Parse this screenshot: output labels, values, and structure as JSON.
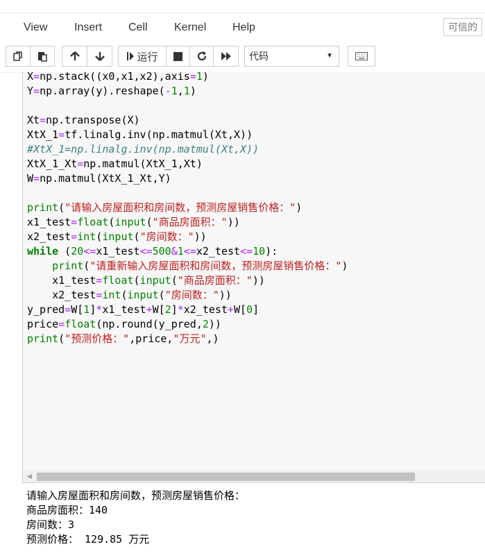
{
  "menubar": {
    "items": [
      "View",
      "Insert",
      "Cell",
      "Kernel",
      "Help"
    ],
    "trusted_label": "可信的"
  },
  "toolbar": {
    "run_label": "运行",
    "cell_type": "代码"
  },
  "code_lines": [
    "X=np.stack((x0,x1,x2),axis=1)",
    "Y=np.array(y).reshape(-1,1)",
    "",
    "Xt=np.transpose(X)",
    "XtX_1=tf.linalg.inv(np.matmul(Xt,X))",
    "#XtX_1=np.linalg.inv(np.matmul(Xt,X))",
    "XtX_1_Xt=np.matmul(XtX_1,Xt)",
    "W=np.matmul(XtX_1_Xt,Y)",
    "",
    "print(\"请输入房屋面积和房间数，预测房屋销售价格：\")",
    "x1_test=float(input(\"商品房面积：\"))",
    "x2_test=int(input(\"房间数：\"))",
    "while (20<=x1_test<=500&1<=x2_test<=10):",
    "    print(\"请重新输入房屋面积和房间数，预测房屋销售价格：\")",
    "    x1_test=float(input(\"商品房面积：\"))",
    "    x2_test=int(input(\"房间数：\"))",
    "y_pred=W[1]*x1_test+W[2]*x2_test+W[0]",
    "price=float(np.round(y_pred,2))",
    "print(\"预测价格：\",price,\"万元\",)"
  ],
  "output_lines": [
    "请输入房屋面积和房间数，预测房屋销售价格：",
    "商品房面积：140",
    "房间数：3",
    "预测价格： 129.85 万元"
  ]
}
